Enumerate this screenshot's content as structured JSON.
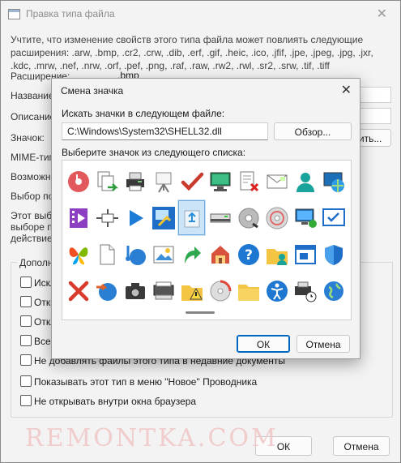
{
  "main_window": {
    "title": "Правка типа файла",
    "close_glyph": "✕",
    "description": "Учтите, что изменение свойств этого типа файла может повлиять следующие расширения: .arw, .bmp, .cr2, .crw, .dib, .erf, .gif, .heic, .ico, .jfif, .jpe, .jpeg, .jpg, .jxr, .kdc, .mrw, .nef, .nrw, .orf, .pef, .png, .raf, .raw, .rw2, .rwl, .sr2, .srw, .tif, .tiff",
    "fields": {
      "extension_label": "Расширение:",
      "extension_value": ".bmp",
      "name_label": "Название т",
      "description_label": "Описание:",
      "icon_label": "Значок:",
      "change_button": "Сменить...",
      "mime_label": "MIME-тип:",
      "possible_label": "Возможны",
      "choice_label": "Выбор пол"
    },
    "partial_text": {
      "line1": "Этот выбо",
      "line2": "выборе пр",
      "line3": "действие "
    },
    "options_group": {
      "title": "Дополни",
      "checkboxes": [
        {
          "label": "Искл"
        },
        {
          "label": "Откр"
        },
        {
          "label": "Откл"
        },
        {
          "label": "Всег"
        },
        {
          "label": "Не добавлять файлы этого типа в недавние документы"
        },
        {
          "label": "Показывать этот тип в меню \"Новое\" Проводника"
        },
        {
          "label": "Не открывать внутри окна браузера"
        }
      ]
    },
    "ok_button": "ОК",
    "cancel_button": "Отмена",
    "watermark": "REMONTKA.COM"
  },
  "dialog": {
    "title": "Смена значка",
    "close_glyph": "✕",
    "search_label": "Искать значки в следующем файле:",
    "path_value": "C:\\Windows\\System32\\SHELL32.dll",
    "browse_button": "Обзор...",
    "select_label": "Выберите значок из следующего списка:",
    "ok_button": "ОК",
    "cancel_button": "Отмена",
    "selected_index": 14,
    "icons": [
      "music-disc-icon",
      "copy-to-icon",
      "printer-icon",
      "presentation-easel-icon",
      "checkmark-icon",
      "monitor-icon",
      "document-delete-icon",
      "envelope-icon",
      "user-icon",
      "globe-monitor-icon",
      "video-file-icon",
      "network-camera-icon",
      "play-arrow-icon",
      "display-properties-icon",
      "recycle-icon",
      "scanner-printer-icon",
      "cd-drive-icon",
      "dvd-disc-icon",
      "monitor-network-icon",
      "checkbox-screen-icon",
      "butterfly-icon",
      "document-icon",
      "music-globe-icon",
      "photo-icon",
      "green-arrow-icon",
      "home-network-icon",
      "help-icon",
      "folder-users-icon",
      "window-maximize-icon",
      "shield-icon",
      "red-x-icon",
      "globe-arrow-icon",
      "camera-icon",
      "scanner-icon",
      "folder-warning-icon",
      "disc-burn-icon",
      "folder-icon",
      "accessibility-icon",
      "printer-clock-icon",
      "globe-icon"
    ]
  }
}
